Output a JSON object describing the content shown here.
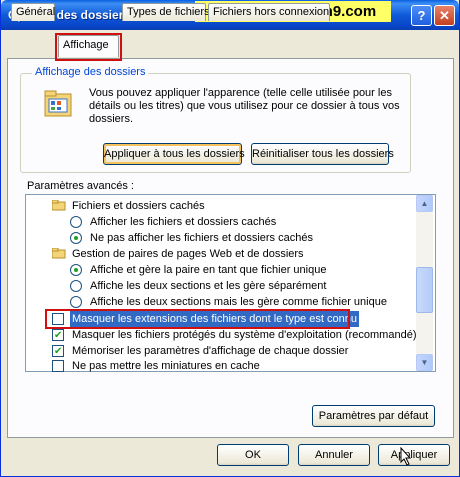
{
  "window": {
    "title": "Options des dossiers",
    "watermark": "http://abhph.mam9.com",
    "help_glyph": "?",
    "close_glyph": "✕"
  },
  "tabs": [
    {
      "label": "Général",
      "active": false
    },
    {
      "label": "Affichage",
      "active": true
    },
    {
      "label": "Types de fichiers",
      "active": false
    },
    {
      "label": "Fichiers hors connexion",
      "active": false
    }
  ],
  "folder_views": {
    "group_label": "Affichage des dossiers",
    "description": "Vous pouvez appliquer l'apparence (telle celle utilisée pour les détails ou les titres) que vous utilisez pour ce dossier à tous vos dossiers.",
    "apply_all_label": "Appliquer à tous les dossiers",
    "reset_all_label": "Réinitialiser tous les dossiers"
  },
  "advanced": {
    "label": "Paramètres avancés :",
    "items": [
      {
        "kind": "folder",
        "label": "Fichiers et dossiers cachés"
      },
      {
        "kind": "radio",
        "checked": false,
        "label": "Afficher les fichiers et dossiers cachés"
      },
      {
        "kind": "radio",
        "checked": true,
        "label": "Ne pas afficher les fichiers et dossiers cachés"
      },
      {
        "kind": "folder",
        "label": "Gestion de paires de pages Web et de dossiers"
      },
      {
        "kind": "radio",
        "checked": true,
        "label": "Affiche et gère la paire en tant que fichier unique"
      },
      {
        "kind": "radio",
        "checked": false,
        "label": "Affiche les deux sections et les gère séparément"
      },
      {
        "kind": "radio",
        "checked": false,
        "label": "Affiche les deux sections mais les gère comme fichier unique"
      },
      {
        "kind": "check",
        "checked": false,
        "selected": true,
        "label": "Masquer les extensions des fichiers dont le type est connu"
      },
      {
        "kind": "check",
        "checked": true,
        "label": "Masquer les fichiers protégés du système d'exploitation (recommandé)"
      },
      {
        "kind": "check",
        "checked": true,
        "label": "Mémoriser les paramètres d'affichage de chaque dossier"
      },
      {
        "kind": "check",
        "checked": false,
        "label": "Ne pas mettre les miniatures en cache"
      }
    ],
    "defaults_label": "Paramètres par défaut"
  },
  "footer": {
    "ok_label": "OK",
    "cancel_label": "Annuler",
    "apply_label": "Appliquer"
  },
  "colors": {
    "title_blue": "#0a5fe0",
    "highlight_red": "#d01010",
    "selection_blue": "#316ac5",
    "watermark_yellow": "#ffff66"
  }
}
